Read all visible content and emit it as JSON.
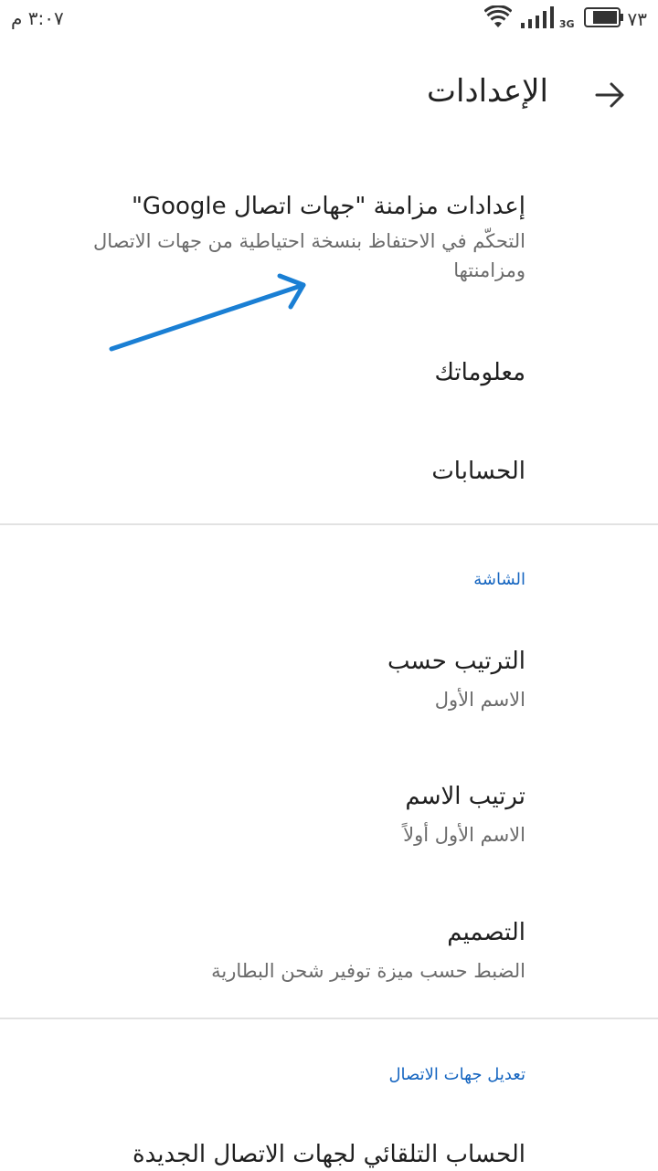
{
  "status_bar": {
    "time": "٣:٠٧ م",
    "network": "3G",
    "battery": "٧٣"
  },
  "app_bar": {
    "title": "الإعدادات"
  },
  "items": {
    "google_sync": {
      "title": "إعدادات مزامنة \"جهات اتصال Google\"",
      "subtitle": "التحكّم في الاحتفاظ بنسخة احتياطية من جهات الاتصال ومزامنتها"
    },
    "your_info": {
      "title": "معلوماتك"
    },
    "accounts": {
      "title": "الحسابات"
    },
    "sort_by": {
      "title": "الترتيب حسب",
      "subtitle": "الاسم الأول"
    },
    "name_format": {
      "title": "ترتيب الاسم",
      "subtitle": "الاسم الأول أولاً"
    },
    "theme": {
      "title": "التصميم",
      "subtitle": "الضبط حسب ميزة توفير شحن البطارية"
    },
    "auto_account": {
      "title": "الحساب التلقائي لجهات الاتصال الجديدة"
    }
  },
  "sections": {
    "display": "الشاشة",
    "edit_contacts": "تعديل جهات الاتصال"
  },
  "colors": {
    "accent": "#1565c0",
    "annotation_arrow": "#1a7fd4"
  }
}
